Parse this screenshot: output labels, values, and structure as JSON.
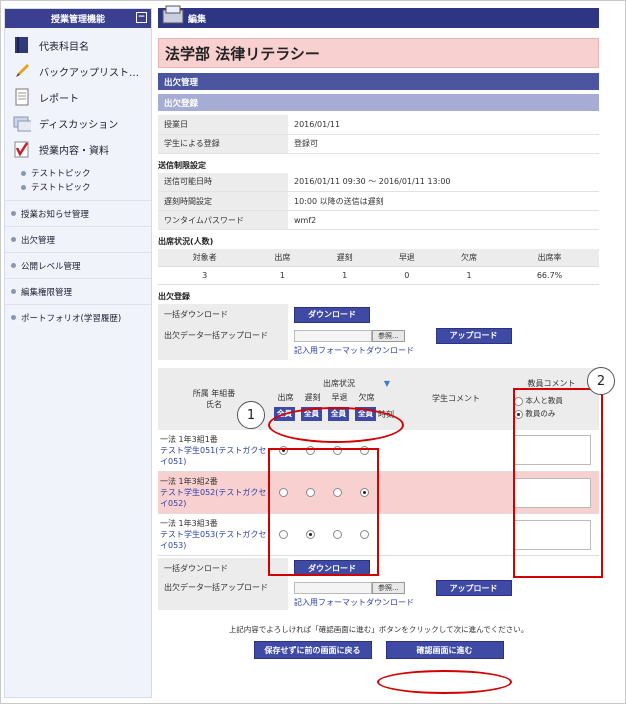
{
  "sidebar": {
    "header": "授業管理機能",
    "items": [
      {
        "label": "代表科目名",
        "icon": "book-icon"
      },
      {
        "label": "バックアップリスト…",
        "icon": "pencil-icon"
      },
      {
        "label": "レポート",
        "icon": "report-icon"
      },
      {
        "label": "ディスカッション",
        "icon": "discussion-icon"
      },
      {
        "label": "授業内容・資料",
        "icon": "materials-icon"
      }
    ],
    "topics": [
      "テストトピック",
      "テストトピック"
    ],
    "sections": [
      "授業お知らせ管理",
      "出欠管理",
      "公開レベル管理",
      "編集権限管理",
      "ポートフォリオ(学習履歴)"
    ]
  },
  "main": {
    "tab": "編集",
    "course_title": "法学部 法律リテラシー",
    "bar_attendance": "出欠管理",
    "bar_register": "出欠登録",
    "class_info": [
      {
        "k": "授業日",
        "v": "2016/01/11"
      },
      {
        "k": "学生による登録",
        "v": "登録可"
      }
    ],
    "send_title": "送信制限設定",
    "send_info": [
      {
        "k": "送信可能日時",
        "v": "2016/01/11 09:30 〜 2016/01/11 13:00"
      },
      {
        "k": "遅刻時間設定",
        "v": "10:00 以降の送信は遅刻"
      },
      {
        "k": "ワンタイムパスワード",
        "v": "wmf2"
      }
    ],
    "stat_title": "出席状況(人数)",
    "stat_headers": [
      "対象者",
      "出席",
      "遅刻",
      "早退",
      "欠席",
      "出席率"
    ],
    "stat_values": [
      "3",
      "1",
      "1",
      "0",
      "1",
      "66.7%"
    ],
    "reg_title": "出欠登録",
    "bulk_download_label": "一括ダウンロード",
    "download_btn": "ダウンロード",
    "bulk_upload_label": "出欠データ一括アップロード",
    "browse_btn": "参照...",
    "upload_btn": "アップロード",
    "format_link": "記入用フォーマットダウンロード",
    "att_header_student": "所属 年組番\n氏名",
    "att_header_status": "出席状況",
    "att_cols": [
      "出席",
      "遅刻",
      "早退",
      "欠席"
    ],
    "att_time": "時刻",
    "all_btn": "全員",
    "student_comment": "学生コメント",
    "teacher_comment": "教員コメント",
    "comment_options": [
      "本人と教員",
      "教員のみ"
    ],
    "students": [
      {
        "cls": "一法 1年3組1番",
        "name": "テスト学生051(テストガクセイ051)",
        "selected": 0
      },
      {
        "cls": "一法 1年3組2番",
        "name": "テスト学生052(テストガクセイ052)",
        "selected": 3
      },
      {
        "cls": "一法 1年3組3番",
        "name": "テスト学生053(テストガクセイ053)",
        "selected": 1
      }
    ],
    "footer_note": "上記内容でよろしければ「確認画面に進む」ボタンをクリックして次に進んでください。",
    "back_btn": "保存せずに前の画面に戻る",
    "confirm_btn": "確認画面に進む",
    "callout_1": "1",
    "callout_2": "2"
  },
  "colors": {
    "accent": "#2e3582",
    "highlight_row": "#f9d0d0",
    "callout": "#d40000"
  }
}
